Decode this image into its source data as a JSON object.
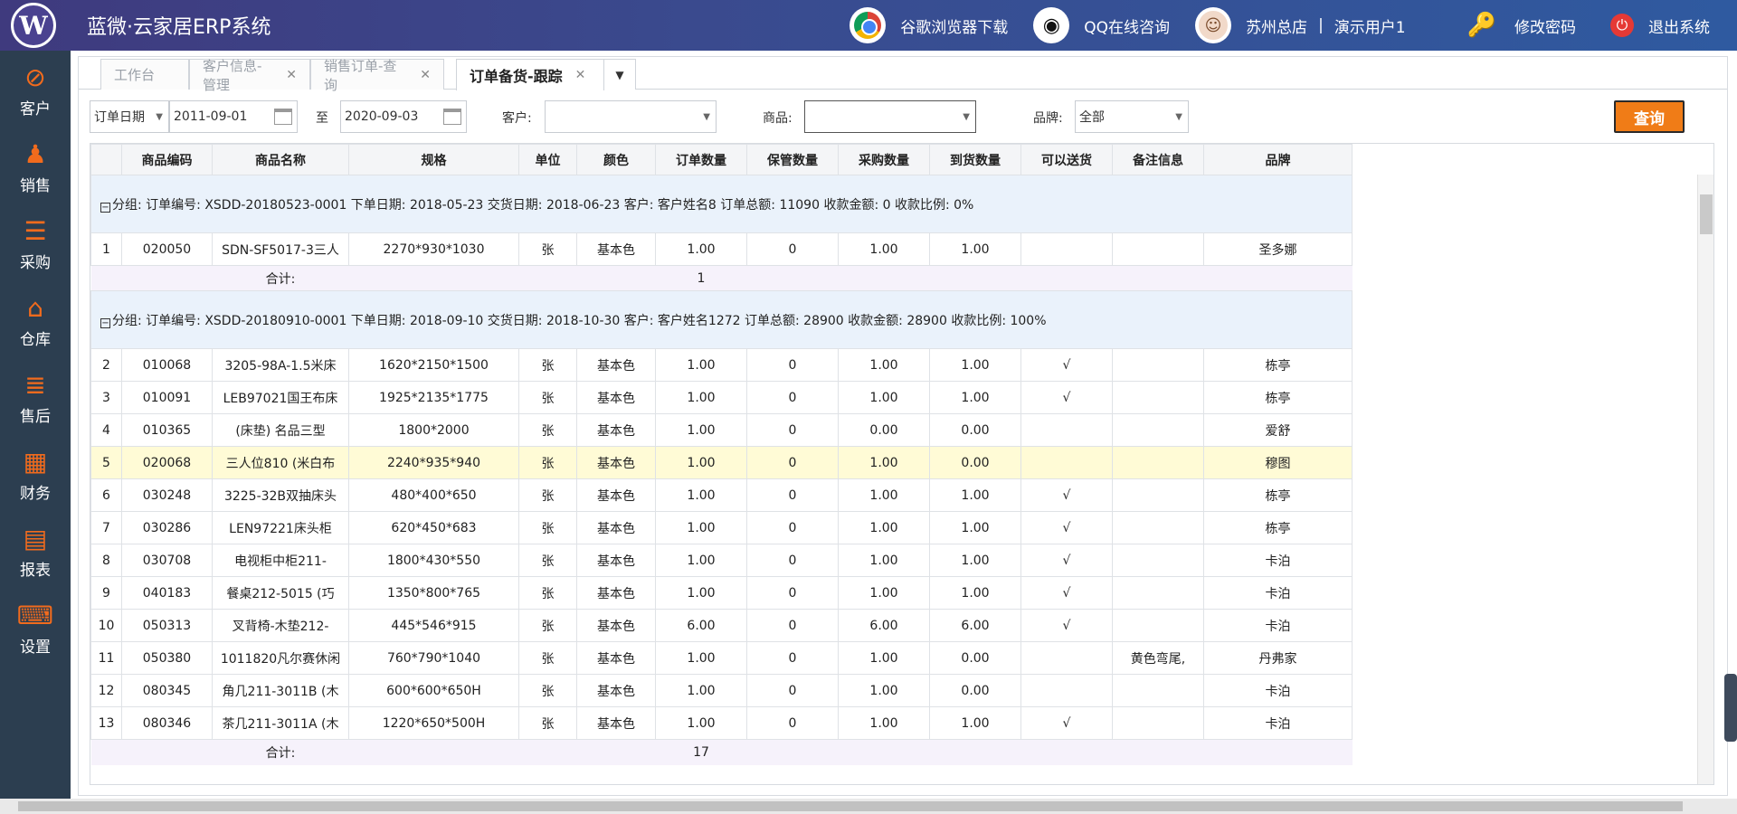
{
  "header": {
    "app_title": "蓝微·云家居ERP系统",
    "logo_letter": "W",
    "actions": {
      "browser_download": "谷歌浏览器下载",
      "qq_consult": "QQ在线咨询",
      "branch": "苏州总店",
      "separator": "|",
      "user": "演示用户1",
      "change_password": "修改密码",
      "logout": "退出系统"
    }
  },
  "sidebar": {
    "items": [
      {
        "label": "客户",
        "icon": "compass-icon"
      },
      {
        "label": "销售",
        "icon": "salesperson-icon"
      },
      {
        "label": "采购",
        "icon": "cart-icon"
      },
      {
        "label": "仓库",
        "icon": "home-icon"
      },
      {
        "label": "售后",
        "icon": "bars-icon"
      },
      {
        "label": "财务",
        "icon": "calculator-icon"
      },
      {
        "label": "报表",
        "icon": "report-icon"
      },
      {
        "label": "设置",
        "icon": "keyboard-icon"
      }
    ]
  },
  "tabs": [
    {
      "label": "工作台"
    },
    {
      "label": "客户信息-管理"
    },
    {
      "label": "销售订单-查询"
    },
    {
      "label": "订单备货-跟踪"
    }
  ],
  "filter": {
    "date_type": "订单日期",
    "date_from": "2011-09-01",
    "to_label": "至",
    "date_to": "2020-09-03",
    "customer_label": "客户:",
    "customer_value": "",
    "product_label": "商品:",
    "product_value": "",
    "brand_label": "品牌:",
    "brand_value": "全部",
    "query_button": "查询"
  },
  "table": {
    "columns": [
      "",
      "商品编码",
      "商品名称",
      "规格",
      "单位",
      "颜色",
      "订单数量",
      "保管数量",
      "采购数量",
      "到货数量",
      "可以送货",
      "备注信息",
      "品牌"
    ],
    "groups": [
      {
        "header": "分组: 订单编号: XSDD-20180523-0001 下单日期: 2018-05-23 交货日期: 2018-06-23 客户: 客户姓名8 订单总额: 11090 收款金额: 0 收款比例: 0%",
        "rows": [
          [
            "1",
            "020050",
            "SDN-SF5017-3三人",
            "2270*930*1030",
            "张",
            "基本色",
            "1.00",
            "0",
            "1.00",
            "1.00",
            "",
            "",
            "圣多娜"
          ]
        ],
        "sum_label": "合计:",
        "sum_value": "1"
      },
      {
        "header": "分组: 订单编号: XSDD-20180910-0001 下单日期: 2018-09-10 交货日期: 2018-10-30 客户: 客户姓名1272 订单总额: 28900 收款金额: 28900 收款比例: 100%",
        "rows": [
          [
            "2",
            "010068",
            "3205-98A-1.5米床",
            "1620*2150*1500",
            "张",
            "基本色",
            "1.00",
            "0",
            "1.00",
            "1.00",
            "√",
            "",
            "栋亭"
          ],
          [
            "3",
            "010091",
            "LEB97021国王布床",
            "1925*2135*1775",
            "张",
            "基本色",
            "1.00",
            "0",
            "1.00",
            "1.00",
            "√",
            "",
            "栋亭"
          ],
          [
            "4",
            "010365",
            "(床垫) 名品三型",
            "1800*2000",
            "张",
            "基本色",
            "1.00",
            "0",
            "0.00",
            "0.00",
            "",
            "",
            "爱舒"
          ],
          [
            "5",
            "020068",
            "三人位810 (米白布",
            "2240*935*940",
            "张",
            "基本色",
            "1.00",
            "0",
            "1.00",
            "0.00",
            "",
            "",
            "穆图"
          ],
          [
            "6",
            "030248",
            "3225-32B双抽床头",
            "480*400*650",
            "张",
            "基本色",
            "1.00",
            "0",
            "1.00",
            "1.00",
            "√",
            "",
            "栋亭"
          ],
          [
            "7",
            "030286",
            "LEN97221床头柜",
            "620*450*683",
            "张",
            "基本色",
            "1.00",
            "0",
            "1.00",
            "1.00",
            "√",
            "",
            "栋亭"
          ],
          [
            "8",
            "030708",
            "电视柜中柜211-",
            "1800*430*550",
            "张",
            "基本色",
            "1.00",
            "0",
            "1.00",
            "1.00",
            "√",
            "",
            "卡泊"
          ],
          [
            "9",
            "040183",
            "餐桌212-5015 (巧",
            "1350*800*765",
            "张",
            "基本色",
            "1.00",
            "0",
            "1.00",
            "1.00",
            "√",
            "",
            "卡泊"
          ],
          [
            "10",
            "050313",
            "叉背椅-木垫212-",
            "445*546*915",
            "张",
            "基本色",
            "6.00",
            "0",
            "6.00",
            "6.00",
            "√",
            "",
            "卡泊"
          ],
          [
            "11",
            "050380",
            "1011820凡尔赛休闲",
            "760*790*1040",
            "张",
            "基本色",
            "1.00",
            "0",
            "1.00",
            "0.00",
            "",
            "黄色弯尾,",
            "丹弗家"
          ],
          [
            "12",
            "080345",
            "角几211-3011B (木",
            "600*600*650H",
            "张",
            "基本色",
            "1.00",
            "0",
            "1.00",
            "0.00",
            "",
            "",
            "卡泊"
          ],
          [
            "13",
            "080346",
            "茶几211-3011A (木",
            "1220*650*500H",
            "张",
            "基本色",
            "1.00",
            "0",
            "1.00",
            "1.00",
            "√",
            "",
            "卡泊"
          ]
        ],
        "sum_label": "合计:",
        "sum_value": "17"
      }
    ],
    "highlighted_row_index": "5",
    "colors": {
      "group_bg": "#eaf2fb",
      "sum_bg": "#f6f2fb",
      "highlight_bg": "#fffbd6",
      "accent": "#f07c17",
      "sidebar_bg": "#2c3e50"
    }
  }
}
